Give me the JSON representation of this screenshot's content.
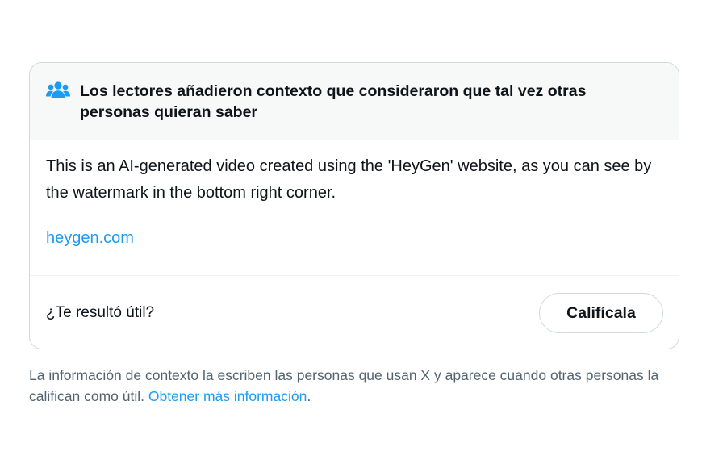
{
  "note": {
    "header_icon": "people-group-icon",
    "header_title": "Los lectores añadieron contexto que consideraron que tal vez otras personas quieran saber",
    "body_text": "This is an AI-generated video created using the 'HeyGen' website, as you can see by the watermark in the bottom right corner.",
    "link_text": "heygen.com",
    "rating_question": "¿Te resultó útil?",
    "rate_button_label": "Califícala"
  },
  "footer": {
    "text": "La información de contexto la escriben las personas que usan X y aparece cuando otras personas la califican como útil.",
    "link_text": "Obtener más información",
    "trailing": "."
  },
  "colors": {
    "accent": "#1d9bf0",
    "text": "#0f1419",
    "muted": "#536471",
    "header_bg": "#f7f9f9",
    "border": "#cfd9de"
  }
}
